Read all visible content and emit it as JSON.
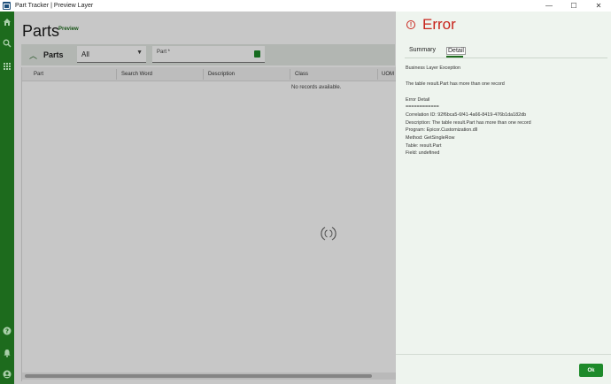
{
  "window": {
    "title": "Part Tracker | Preview Layer",
    "controls": [
      "—",
      "☐",
      "✕"
    ]
  },
  "rail": {
    "icons": [
      "home-icon",
      "search-icon",
      "apps-grid-icon",
      "help-icon",
      "notification-bell-icon",
      "user-icon"
    ]
  },
  "page": {
    "title": "Parts",
    "badge": "Preview"
  },
  "card": {
    "title": "Parts",
    "filter_value": "All",
    "part_placeholder": "Part *"
  },
  "grid": {
    "columns": [
      "Part",
      "Search Word",
      "Description",
      "Class",
      "UOM"
    ],
    "empty_message": "No records available."
  },
  "error_panel": {
    "title": "Error",
    "tabs": {
      "summary": "Summary",
      "detail": "Detail",
      "active": "Detail"
    },
    "lines": {
      "exception_type": "Business Layer Exception",
      "message": "The table result.Part has more than one record",
      "detail_heading": "Error Detail",
      "separator": "============",
      "correlation": "Correlation ID: 92f6bca5-6f41-4a66-8419-476b1da182db",
      "description": "Description: The table result.Part has more than one record",
      "program": "Program: Epicor.Customization.dll",
      "method": "Method: GetSingleRow",
      "table": "Table: result.Part",
      "field": "Field: undefined"
    },
    "ok_label": "Ok"
  },
  "colors": {
    "rail": "#1d6b1d",
    "accent_green": "#1d8a2a",
    "error_red": "#c8231b",
    "panel_bg": "#eef4ee"
  }
}
